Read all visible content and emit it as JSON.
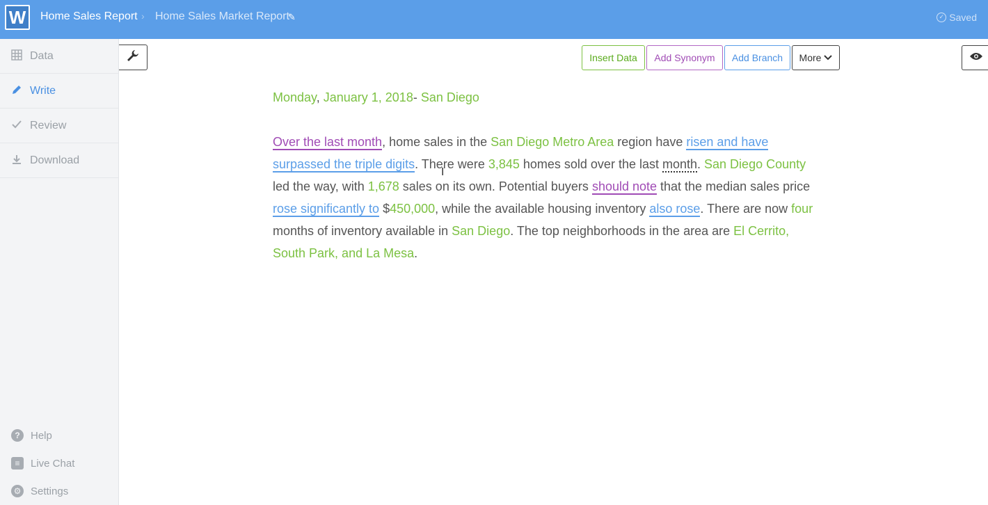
{
  "header": {
    "logo": "W",
    "breadcrumb_home": "Home Sales Report",
    "breadcrumb_sep": "›",
    "breadcrumb_doc": "Home Sales Market Report",
    "saved": "Saved"
  },
  "sidebar": {
    "items": [
      {
        "label": "Data",
        "icon": "grid-icon"
      },
      {
        "label": "Write",
        "icon": "pencil-icon"
      },
      {
        "label": "Review",
        "icon": "check-icon"
      },
      {
        "label": "Download",
        "icon": "download-icon"
      }
    ],
    "bottom": [
      {
        "label": "Help",
        "icon": "help-icon"
      },
      {
        "label": "Live Chat",
        "icon": "chat-icon"
      },
      {
        "label": "Settings",
        "icon": "gear-icon"
      }
    ]
  },
  "toolbar": {
    "insert_data": "Insert Data",
    "add_synonym": "Add Synonym",
    "add_branch": "Add Branch",
    "more": "More"
  },
  "document": {
    "date_day": "Monday",
    "date_comma": ",",
    "date_full": "January 1, 2018",
    "date_dash": "-",
    "date_city": "San Diego",
    "t1": "Over the last month",
    "t2": ", home sales in the ",
    "t3": "San Diego Metro Area",
    "t4": " region have ",
    "t5": "risen and have surpassed the triple digits",
    "t6": ". There were ",
    "t7": "3,845",
    "t8": " homes sold over the last ",
    "t9": "month",
    "t10": ". ",
    "t11": "San Diego County",
    "t12": " led the way, with ",
    "t13": "1,678",
    "t14": " sales on its own. Potential buyers ",
    "t15": "should note",
    "t16": " that the median sales price ",
    "t17": "rose significantly to",
    "t18": " $",
    "t19": "450,000",
    "t20": ", while the available housing inventory ",
    "t21": "also rose",
    "t22": ". There are now ",
    "t23": "four",
    "t24": " months of inventory available in ",
    "t25": "San Diego",
    "t26": ". The top neighborhoods in the area are ",
    "t27": "El Cerrito, South Park, and La Mesa",
    "t28": "."
  },
  "colors": {
    "header": "#5b9ee8",
    "data_token": "#7cc142",
    "synonym_token": "#a04bb5",
    "branch_token": "#5b9ee8"
  }
}
